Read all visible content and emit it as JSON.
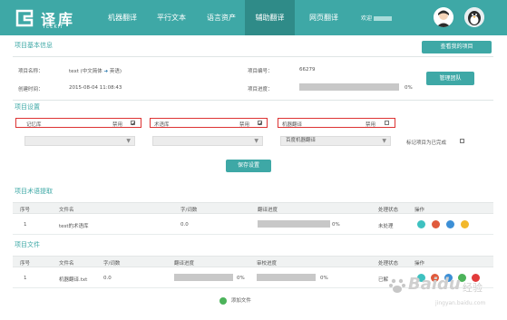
{
  "header": {
    "logo": {
      "name": "译库",
      "sub": "YEEKIT"
    },
    "nav": [
      {
        "label": "机器翻译",
        "active": false
      },
      {
        "label": "平行文本",
        "active": false
      },
      {
        "label": "语言资产",
        "active": false
      },
      {
        "label": "辅助翻译",
        "active": true
      },
      {
        "label": "网页翻译",
        "active": false
      }
    ],
    "welcome": "欢迎"
  },
  "project_info": {
    "title": "项目基本信息",
    "view_button": "查看我的项目",
    "manage_button": "管理团队",
    "name_label": "项目名称：",
    "name_value": "text (中文简体",
    "name_target": "英语)",
    "created_label": "创建时间：",
    "created_value": "2015-08-04 11:08:43",
    "id_label": "项目编号：",
    "id_value": "66279",
    "progress_label": "项目进度：",
    "progress_value": "0%",
    "progress_fraction": 0
  },
  "settings": {
    "title": "项目设置",
    "memory_label": "记忆库",
    "term_label": "术语库",
    "mt_label": "机器翻译",
    "disable_label": "禁用",
    "memory_disabled": true,
    "term_disabled": true,
    "mt_disabled": false,
    "mt_engine": "百度机器翻译",
    "mark_complete_label": "标记项目为已完成",
    "save_button": "保存设置"
  },
  "term_extraction": {
    "title": "项目术语提取",
    "columns": [
      "序号",
      "文件名",
      "字/词数",
      "翻译进度",
      "处理状态",
      "操作"
    ],
    "rows": [
      {
        "index": "1",
        "file": "test的术语库",
        "count": "0.0",
        "progress": "0%",
        "progress_fraction": 0,
        "status": "未处理"
      }
    ]
  },
  "project_files": {
    "title": "项目文件",
    "columns": [
      "序号",
      "文件名",
      "字/词数",
      "翻译进度",
      "审校进度",
      "处理状态",
      "操作"
    ],
    "rows": [
      {
        "index": "1",
        "file": "机器翻译.txt",
        "count": "0.0",
        "translate_progress": "0%",
        "translate_fraction": 0,
        "review_progress": "0%",
        "review_fraction": 0,
        "status": "已解"
      }
    ],
    "add_file_label": "添加文件"
  },
  "watermark": {
    "text": "Baidu",
    "sub": "经验",
    "url": "jingyan.baidu.com"
  },
  "colors": {
    "brand": "#3ea8a6",
    "nav_active": "#2f8b88",
    "highlight_border": "#dd3333"
  }
}
